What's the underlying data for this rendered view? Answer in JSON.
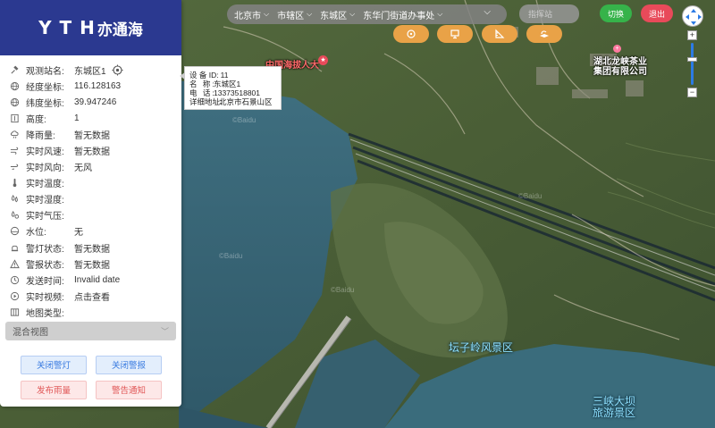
{
  "brand": {
    "logo_mark": "Y T H",
    "logo_text": "亦通海"
  },
  "breadcrumb": [
    {
      "label": "北京市"
    },
    {
      "label": "市辖区"
    },
    {
      "label": "东城区"
    },
    {
      "label": "东华门街道办事处"
    }
  ],
  "search": {
    "placeholder": "指挥站"
  },
  "header_buttons": {
    "switch_label": "切换",
    "exit_label": "退出"
  },
  "tools": [
    {
      "icon": "target-icon"
    },
    {
      "icon": "monitor-icon"
    },
    {
      "icon": "ruler-icon"
    },
    {
      "icon": "layers-icon"
    }
  ],
  "station": {
    "rows": [
      {
        "icon": "satellite-icon",
        "label": "观测站名:",
        "value": "东城区1"
      },
      {
        "icon": "globe-icon",
        "label": "经度坐标:",
        "value": "116.128163"
      },
      {
        "icon": "globe-icon",
        "label": "纬度坐标:",
        "value": "39.947246"
      },
      {
        "icon": "height-icon",
        "label": "高度:",
        "value": "1"
      },
      {
        "icon": "rain-icon",
        "label": "降雨量:",
        "value": "暂无数据"
      },
      {
        "icon": "wind-icon",
        "label": "实时风速:",
        "value": "暂无数据"
      },
      {
        "icon": "wind-direction-icon",
        "label": "实时风向:",
        "value": "无风"
      },
      {
        "icon": "thermometer-icon",
        "label": "实时温度:",
        "value": ""
      },
      {
        "icon": "humidity-icon",
        "label": "实时湿度:",
        "value": ""
      },
      {
        "icon": "pressure-icon",
        "label": "实时气压:",
        "value": ""
      },
      {
        "icon": "water-level-icon",
        "label": "水位:",
        "value": "无"
      },
      {
        "icon": "bell-icon",
        "label": "警灯状态:",
        "value": "暂无数据"
      },
      {
        "icon": "warning-icon",
        "label": "警报状态:",
        "value": "暂无数据"
      },
      {
        "icon": "clock-icon",
        "label": "发送时间:",
        "value": "Invalid date"
      },
      {
        "icon": "camera-icon",
        "label": "实时视频:",
        "value": "点击查看"
      },
      {
        "icon": "map-type-icon",
        "label": "地图类型:",
        "value": ""
      }
    ],
    "map_type_value": "混合视图"
  },
  "actions": {
    "close_light": "关闭警灯",
    "close_alarm": "关闭警报",
    "publish_rain": "发布雨量",
    "warning_notice": "警告通知"
  },
  "tooltip": {
    "device_id_label": "设 备 ID:",
    "device_id": "11",
    "name_label": "名 称:",
    "name": "东城区1",
    "phone_label": "电 话:",
    "phone": "13373518801",
    "address_label": "详细地址:",
    "address": "北京市石景山区"
  },
  "map_labels": {
    "poi_red": "中国海拔人大",
    "company": "湖北龙峡茶业\n集团有限公司",
    "scenic1": "坛子岭风景区",
    "scenic2": "三峡大坝\n旅游景区",
    "watermark": "©Baidu"
  },
  "colors": {
    "brand_bar": "#2b3990",
    "switch": "#36b34a",
    "exit": "#e84a5a",
    "tool": "#e9a247"
  }
}
